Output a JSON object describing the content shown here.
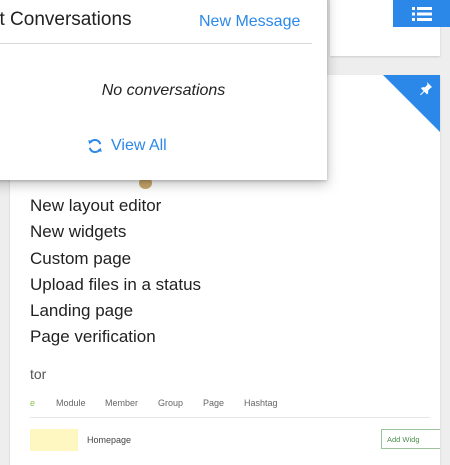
{
  "popup": {
    "title": "st Conversations",
    "new_message_label": "New Message",
    "empty_text": "No conversations",
    "view_all_label": "View All"
  },
  "feed": {
    "items": [
      {
        "label": "New layout editor"
      },
      {
        "label": "New widgets"
      },
      {
        "label": "Custom page"
      },
      {
        "label": "Upload files in a status"
      },
      {
        "label": "Landing page"
      },
      {
        "label": "Page verification"
      }
    ],
    "section_heading": "tor"
  },
  "editor_screenshot": {
    "tabs": [
      "e",
      "Module",
      "Member",
      "Group",
      "Page",
      "Hashtag"
    ],
    "row_label": "Homepage",
    "add_widget_label": "Add Widg"
  },
  "icons": {
    "menu": "list-icon",
    "pin": "pin-icon",
    "refresh": "refresh-icon"
  },
  "colors": {
    "accent": "#2b88e8",
    "background": "#eeeeee"
  }
}
